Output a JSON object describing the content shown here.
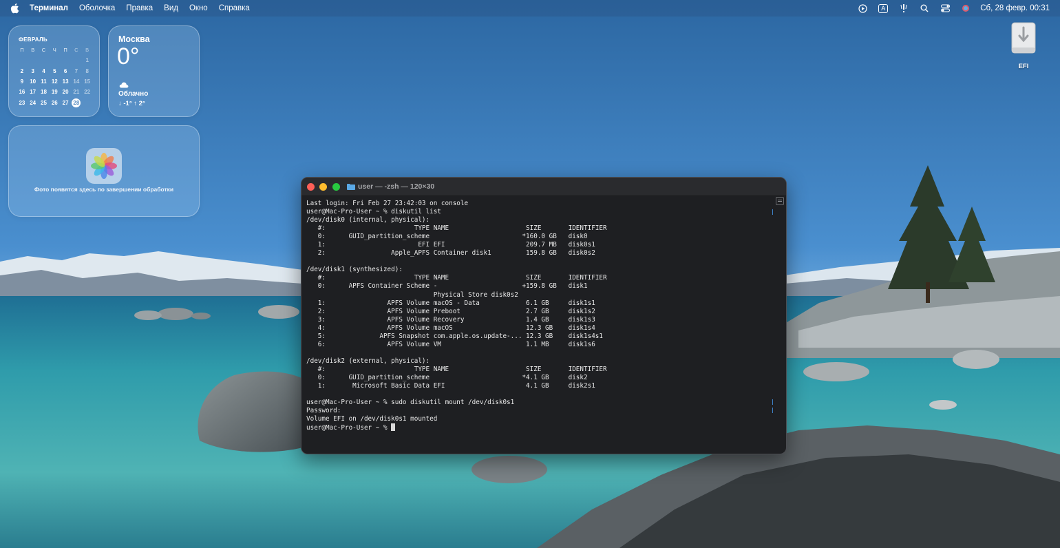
{
  "menubar": {
    "app_name": "Терминал",
    "items": [
      "Оболочка",
      "Правка",
      "Вид",
      "Окно",
      "Справка"
    ],
    "input_source": "A",
    "clock": "Сб, 28 февр.  00:31"
  },
  "calendar_widget": {
    "month": "ФЕВРАЛЬ",
    "weekdays": [
      "П",
      "В",
      "С",
      "Ч",
      "П",
      "С",
      "В"
    ],
    "weeks": [
      [
        "",
        "",
        "",
        "",
        "",
        "",
        "1"
      ],
      [
        "2",
        "3",
        "4",
        "5",
        "6",
        "7",
        "8"
      ],
      [
        "9",
        "10",
        "11",
        "12",
        "13",
        "14",
        "15"
      ],
      [
        "16",
        "17",
        "18",
        "19",
        "20",
        "21",
        "22"
      ],
      [
        "23",
        "24",
        "25",
        "26",
        "27",
        "28",
        ""
      ]
    ],
    "today": "28"
  },
  "weather_widget": {
    "city": "Москва",
    "temperature": "0°",
    "condition": "Облачно",
    "range": "↓ -1° ↑ 2°"
  },
  "photos_widget": {
    "message": "Фото появятся здесь по завершении обработки"
  },
  "desktop": {
    "efi_label": "EFI"
  },
  "terminal": {
    "title": "user — -zsh — 120×30",
    "prompt": "user@Mac-Pro-User ~ % ",
    "output": "Last login: Fri Feb 27 23:42:03 on console\nuser@Mac-Pro-User ~ % diskutil list\n/dev/disk0 (internal, physical):\n   #:                       TYPE NAME                    SIZE       IDENTIFIER\n   0:      GUID_partition_scheme                        *160.0 GB   disk0\n   1:                        EFI EFI                     209.7 MB   disk0s1\n   2:                 Apple_APFS Container disk1         159.8 GB   disk0s2\n\n/dev/disk1 (synthesized):\n   #:                       TYPE NAME                    SIZE       IDENTIFIER\n   0:      APFS Container Scheme -                      +159.8 GB   disk1\n                                 Physical Store disk0s2\n   1:                APFS Volume macOS - Data            6.1 GB     disk1s1\n   2:                APFS Volume Preboot                 2.7 GB     disk1s2\n   3:                APFS Volume Recovery                1.4 GB     disk1s3\n   4:                APFS Volume macOS                   12.3 GB    disk1s4\n   5:              APFS Snapshot com.apple.os.update-... 12.3 GB    disk1s4s1\n   6:                APFS Volume VM                      1.1 MB     disk1s6\n\n/dev/disk2 (external, physical):\n   #:                       TYPE NAME                    SIZE       IDENTIFIER\n   0:      GUID_partition_scheme                        *4.1 GB     disk2\n   1:       Microsoft Basic Data EFI                     4.1 GB     disk2s1\n\nuser@Mac-Pro-User ~ % sudo diskutil mount /dev/disk0s1\nPassword:\nVolume EFI on /dev/disk0s1 mounted\n"
  },
  "colors": {
    "sky": "#2f6fa8",
    "water": "#3b9aa8",
    "terminal_bg": "#1e1f22",
    "close": "#fe5f57",
    "minimize": "#febc2e",
    "zoom": "#28c840"
  }
}
